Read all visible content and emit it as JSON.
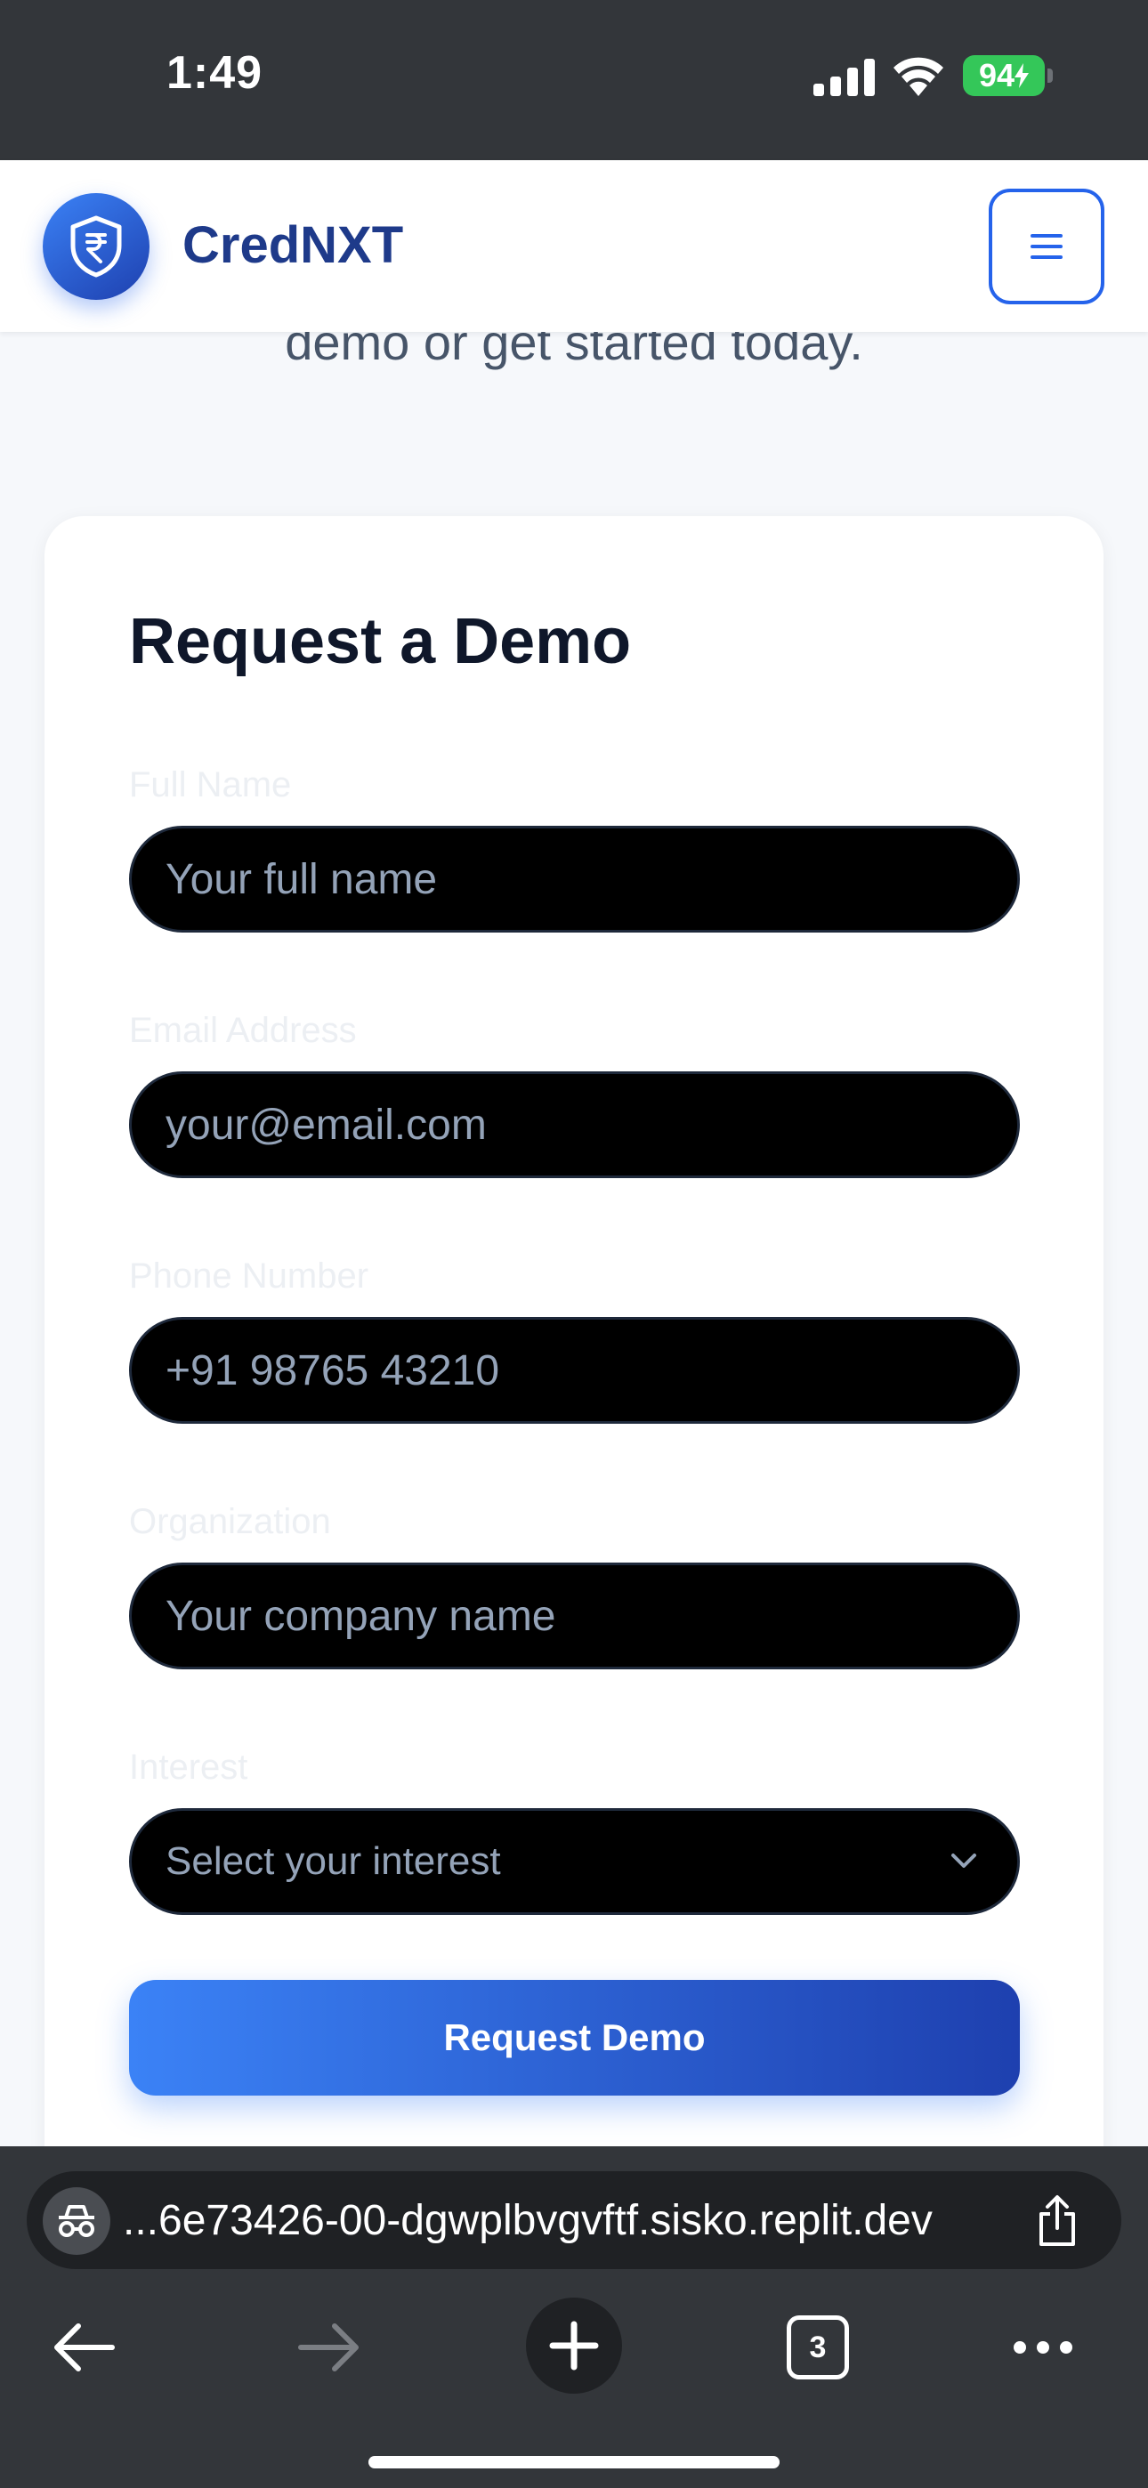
{
  "status_bar": {
    "time": "1:49",
    "battery": "94",
    "battery_color": "#34c759"
  },
  "header": {
    "brand": "CredNXT",
    "logo_icon": "shield-rupee-icon",
    "menu_icon": "hamburger-icon",
    "accent_color": "#2563eb"
  },
  "intro": {
    "text_tail": "demo or get started today."
  },
  "form": {
    "title": "Request a Demo",
    "fields": [
      {
        "label": "Full Name",
        "placeholder": "Your full name"
      },
      {
        "label": "Email Address",
        "placeholder": "your@email.com"
      },
      {
        "label": "Phone Number",
        "placeholder": "+91 98765 43210"
      },
      {
        "label": "Organization",
        "placeholder": "Your company name"
      },
      {
        "label": "Interest",
        "placeholder": "Select your interest"
      }
    ],
    "submit_label": "Request Demo"
  },
  "browser": {
    "url": "...6e73426-00-dgwplbvgvftf.sisko.replit.dev",
    "tab_count": "3",
    "icons": [
      "incognito-icon",
      "share-icon",
      "back-arrow-icon",
      "forward-arrow-icon",
      "plus-icon",
      "tabs-icon",
      "more-icon"
    ]
  }
}
